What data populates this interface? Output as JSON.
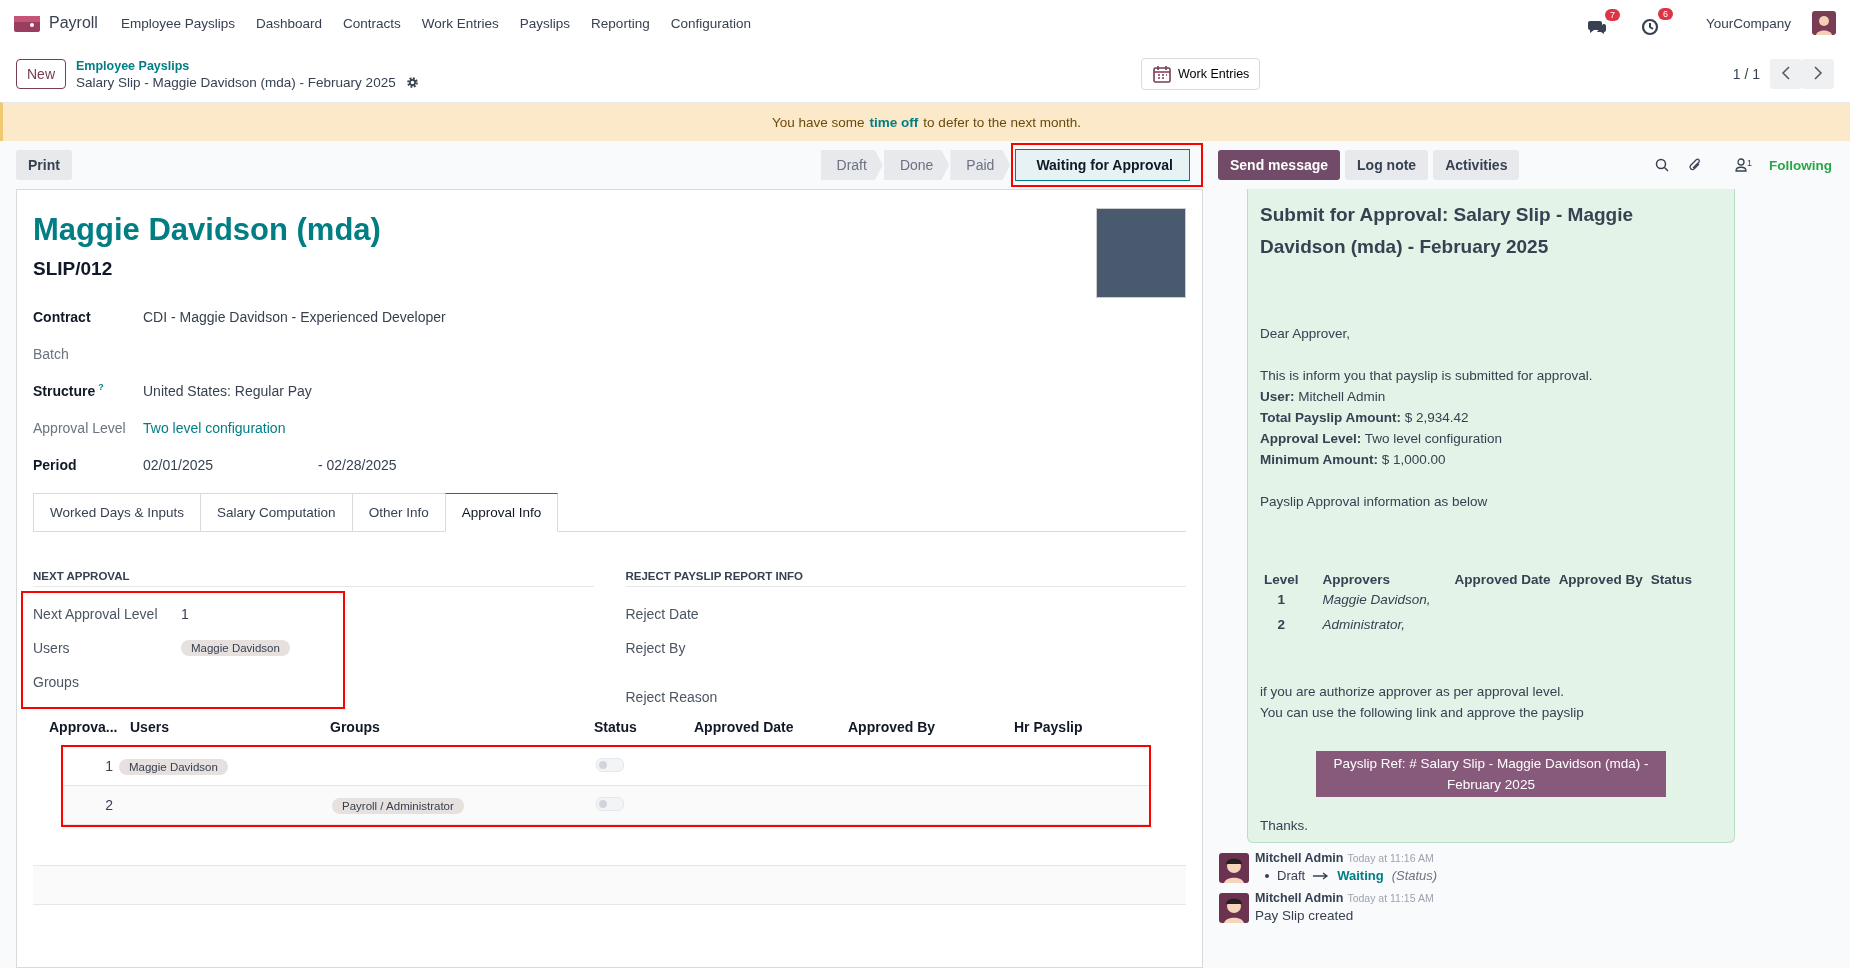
{
  "navbar": {
    "app": "Payroll",
    "menu": [
      "Employee Payslips",
      "Dashboard",
      "Contracts",
      "Work Entries",
      "Payslips",
      "Reporting",
      "Configuration"
    ],
    "messages_badge": "7",
    "activities_badge": "6",
    "company": "YourCompany"
  },
  "control_panel": {
    "new_button": "New",
    "breadcrumb": "Employee Payslips",
    "record": "Salary Slip - Maggie Davidson (mda) - February 2025",
    "smart_button": "Work Entries",
    "pager": "1 / 1"
  },
  "banner": {
    "before": "You have some",
    "link": "time off",
    "after": "to defer to the next month."
  },
  "status_bar": {
    "print": "Print",
    "stages": [
      {
        "label": "Draft",
        "selected": false
      },
      {
        "label": "Done",
        "selected": false
      },
      {
        "label": "Paid",
        "selected": false
      },
      {
        "label": "Waiting for Approval",
        "selected": true
      }
    ]
  },
  "chatter_actions": {
    "send": "Send message",
    "log": "Log note",
    "activities": "Activities",
    "followers_count": "1",
    "following": "Following"
  },
  "form": {
    "title": "Maggie Davidson (mda)",
    "reference": "SLIP/012",
    "fields": [
      {
        "label": "Contract",
        "required": true,
        "kind": "text",
        "value": "CDI - Maggie Davidson - Experienced Developer"
      },
      {
        "label": "Batch",
        "required": false,
        "kind": "empty"
      },
      {
        "label": "Structure",
        "required": true,
        "kind": "text",
        "help": "?",
        "value": "United States: Regular Pay"
      },
      {
        "label": "Approval Level",
        "required": false,
        "kind": "link",
        "value": "Two level configuration"
      },
      {
        "label": "Period",
        "required": true,
        "kind": "period",
        "value": "02/01/2025",
        "value_end": "- 02/28/2025"
      }
    ],
    "tabs": [
      {
        "label": "Worked Days & Inputs",
        "selected": false
      },
      {
        "label": "Salary Computation",
        "selected": false
      },
      {
        "label": "Other Info",
        "selected": false
      },
      {
        "label": "Approval Info",
        "selected": true
      }
    ],
    "next_approval": {
      "heading": "NEXT APPROVAL",
      "fields": [
        {
          "label": "Next Approval Level",
          "value": "1"
        },
        {
          "label": "Users",
          "tags": [
            "Maggie Davidson"
          ]
        },
        {
          "label": "Groups"
        }
      ]
    },
    "reject_info": {
      "heading": "REJECT PAYSLIP REPORT INFO",
      "fields": [
        "Reject Date",
        "Reject By",
        "Reject Reason"
      ]
    },
    "approval_table": {
      "columns": [
        "Approva...",
        "Users",
        "Groups",
        "Status",
        "Approved Date",
        "Approved By",
        "Hr Payslip"
      ],
      "rows": [
        {
          "level": "1",
          "users": [
            "Maggie Davidson"
          ],
          "groups": [],
          "status": false
        },
        {
          "level": "2",
          "users": [],
          "groups": [
            "Payroll / Administrator"
          ],
          "status": false
        }
      ]
    }
  },
  "mail": {
    "title": "Submit for Approval: Salary Slip - Maggie Davidson (mda) - February 2025",
    "greeting": "Dear Approver,",
    "lines": [
      "This is inform you that payslip is submitted for approval.",
      "**User:** Mitchell Admin",
      "**Total Payslip Amount:** $ 2,934.42",
      "**Approval Level:** Two level configuration",
      "**Minimum Amount:** $ 1,000.00"
    ],
    "intro": "Payslip Approval information as below",
    "table_columns": [
      "Level",
      "Approvers",
      "Approved Date",
      "Approved By",
      "Status"
    ],
    "table_rows": [
      {
        "level": "1",
        "approvers": "Maggie Davidson,"
      },
      {
        "level": "2",
        "approvers": "Administrator,"
      }
    ],
    "footer_lines": [
      "if you are authorize approver as per approval level.",
      "You can use the following link and approve the payslip"
    ],
    "link": "Payslip Ref: # Salary Slip - Maggie Davidson (mda) - February 2025",
    "thanks": "Thanks."
  },
  "messages": [
    {
      "author": "Mitchell Admin",
      "time": "Today at 11:16 AM",
      "kind": "tracking",
      "old": "Draft",
      "new": "Waiting",
      "field": "(Status)"
    },
    {
      "author": "Mitchell Admin",
      "time": "Today at 11:15 AM",
      "kind": "text",
      "body": "Pay Slip created"
    }
  ]
}
